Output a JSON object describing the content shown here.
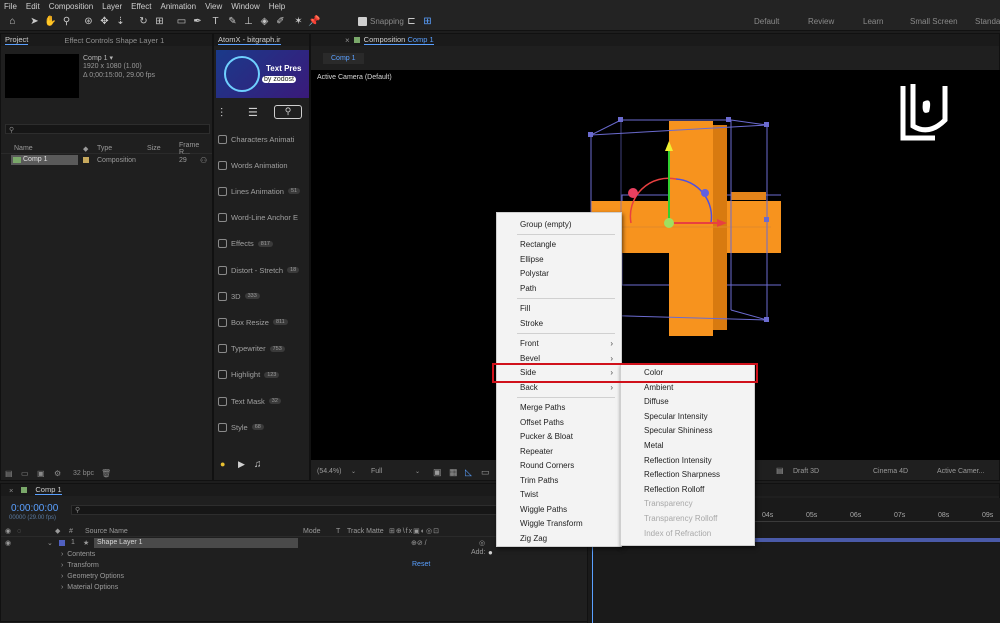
{
  "menubar": [
    "File",
    "Edit",
    "Composition",
    "Layer",
    "Effect",
    "Animation",
    "View",
    "Window",
    "Help"
  ],
  "toolbar": {
    "snapping_label": "Snapping"
  },
  "workspaces": [
    "Default",
    "Review",
    "Learn",
    "Small Screen",
    "Standard"
  ],
  "project": {
    "tab": "Project",
    "effect_tab": "Effect Controls Shape Layer 1",
    "comp_name": "Comp 1 ▾",
    "comp_size": "1920 x 1080 (1.00)",
    "comp_duration": "Δ 0;00:15:00, 29.00 fps",
    "columns": {
      "name": "Name",
      "type": "Type",
      "size": "Size",
      "frame": "Frame R..."
    },
    "item": {
      "name": "Comp 1",
      "type": "Composition",
      "frame": "29"
    },
    "bpc": "32 bpc"
  },
  "atomx": {
    "tab": "AtomX - bitgraph.ir",
    "banner_title": "Text Pres",
    "banner_by": "by zodost",
    "items": [
      {
        "label": "Characters Animati",
        "count": ""
      },
      {
        "label": "Words Animation",
        "count": ""
      },
      {
        "label": "Lines Animation",
        "count": "51"
      },
      {
        "label": "Word-Line Anchor E",
        "count": ""
      },
      {
        "label": "Effects",
        "count": "817"
      },
      {
        "label": "Distort - Stretch",
        "count": "18"
      },
      {
        "label": "3D",
        "count": "333"
      },
      {
        "label": "Box Resize",
        "count": "811"
      },
      {
        "label": "Typewriter",
        "count": "753"
      },
      {
        "label": "Highlight",
        "count": "123"
      },
      {
        "label": "Text Mask",
        "count": "32"
      },
      {
        "label": "Style",
        "count": "68"
      }
    ]
  },
  "composition": {
    "tab_prefix": "Composition",
    "tab_name": "Comp 1",
    "subtab": "Comp 1",
    "camera_label": "Active Camera (Default)",
    "zoom": "(54.4%)",
    "resolution": "Full",
    "renderer_draft": "Draft 3D",
    "renderer": "Cinema 4D",
    "camera_select": "Active Camer..."
  },
  "context_menu": {
    "items": [
      {
        "label": "Group (empty)",
        "arrow": false
      },
      {
        "label": "Rectangle",
        "arrow": false
      },
      {
        "label": "Ellipse",
        "arrow": false
      },
      {
        "label": "Polystar",
        "arrow": false
      },
      {
        "label": "Path",
        "arrow": false
      },
      {
        "label": "Fill",
        "arrow": false
      },
      {
        "label": "Stroke",
        "arrow": false
      },
      {
        "label": "Front",
        "arrow": true
      },
      {
        "label": "Bevel",
        "arrow": true
      },
      {
        "label": "Side",
        "arrow": true
      },
      {
        "label": "Back",
        "arrow": true
      },
      {
        "label": "Merge Paths",
        "arrow": false
      },
      {
        "label": "Offset Paths",
        "arrow": false
      },
      {
        "label": "Pucker & Bloat",
        "arrow": false
      },
      {
        "label": "Repeater",
        "arrow": false
      },
      {
        "label": "Round Corners",
        "arrow": false
      },
      {
        "label": "Trim Paths",
        "arrow": false
      },
      {
        "label": "Twist",
        "arrow": false
      },
      {
        "label": "Wiggle Paths",
        "arrow": false
      },
      {
        "label": "Wiggle Transform",
        "arrow": false
      },
      {
        "label": "Zig Zag",
        "arrow": false
      }
    ]
  },
  "submenu": {
    "items": [
      {
        "label": "Color",
        "disabled": false
      },
      {
        "label": "Ambient",
        "disabled": false
      },
      {
        "label": "Diffuse",
        "disabled": false
      },
      {
        "label": "Specular Intensity",
        "disabled": false
      },
      {
        "label": "Specular Shininess",
        "disabled": false
      },
      {
        "label": "Metal",
        "disabled": false
      },
      {
        "label": "Reflection Intensity",
        "disabled": false
      },
      {
        "label": "Reflection Sharpness",
        "disabled": false
      },
      {
        "label": "Reflection Rolloff",
        "disabled": false
      },
      {
        "label": "Transparency",
        "disabled": true
      },
      {
        "label": "Transparency Rolloff",
        "disabled": true
      },
      {
        "label": "Index of Refraction",
        "disabled": true
      }
    ]
  },
  "timeline": {
    "tab": "Comp 1",
    "timecode": "0:00:00:00",
    "fps": "00000 (29.00 fps)",
    "columns": {
      "source": "Source Name",
      "mode": "Mode",
      "t": "T",
      "matte": "Track Matte"
    },
    "layer_num": "1",
    "layer_name": "Shape Layer 1",
    "props": [
      "Contents",
      "Transform",
      "Geometry Options",
      "Material Options"
    ],
    "add_label": "Add:",
    "reset_label": "Reset",
    "ruler": [
      "04s",
      "05s",
      "06s",
      "07s",
      "08s",
      "09s"
    ]
  },
  "colors": {
    "accent_red": "#d0111b",
    "shape_orange": "#f7931e",
    "wire_blue": "#6b6bd0",
    "timecode_blue": "#5aa0ff"
  }
}
